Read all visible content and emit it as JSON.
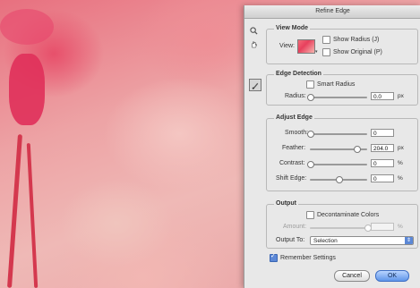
{
  "dialog": {
    "title": "Refine Edge",
    "view_mode": {
      "title": "View Mode",
      "view_label": "View:",
      "show_radius": {
        "label": "Show Radius (J)",
        "checked": false
      },
      "show_original": {
        "label": "Show Original (P)",
        "checked": false
      }
    },
    "edge_detection": {
      "title": "Edge Detection",
      "smart_radius": {
        "label": "Smart Radius",
        "checked": false
      },
      "radius": {
        "label": "Radius:",
        "value": "0.0",
        "unit": "px",
        "level": 0.0
      }
    },
    "adjust_edge": {
      "title": "Adjust Edge",
      "smooth": {
        "label": "Smooth:",
        "value": "0",
        "unit": "",
        "level": 0.0
      },
      "feather": {
        "label": "Feather:",
        "value": "204.0",
        "unit": "px",
        "level": 0.82
      },
      "contrast": {
        "label": "Contrast:",
        "value": "0",
        "unit": "%",
        "level": 0.0
      },
      "shift_edge": {
        "label": "Shift Edge:",
        "value": "0",
        "unit": "%",
        "level": 0.5
      }
    },
    "output": {
      "title": "Output",
      "decontaminate": {
        "label": "Decontaminate Colors",
        "checked": false
      },
      "amount": {
        "label": "Amount:",
        "value": "",
        "unit": "%",
        "level": 1.0
      },
      "output_to": {
        "label": "Output To:",
        "value": "Selection"
      }
    },
    "remember": {
      "label": "Remember Settings",
      "checked": true
    },
    "buttons": {
      "cancel": "Cancel",
      "ok": "OK"
    }
  },
  "icons": {
    "zoom": "magnifier-icon",
    "hand": "hand-icon",
    "refine_radius": "brush-icon"
  }
}
